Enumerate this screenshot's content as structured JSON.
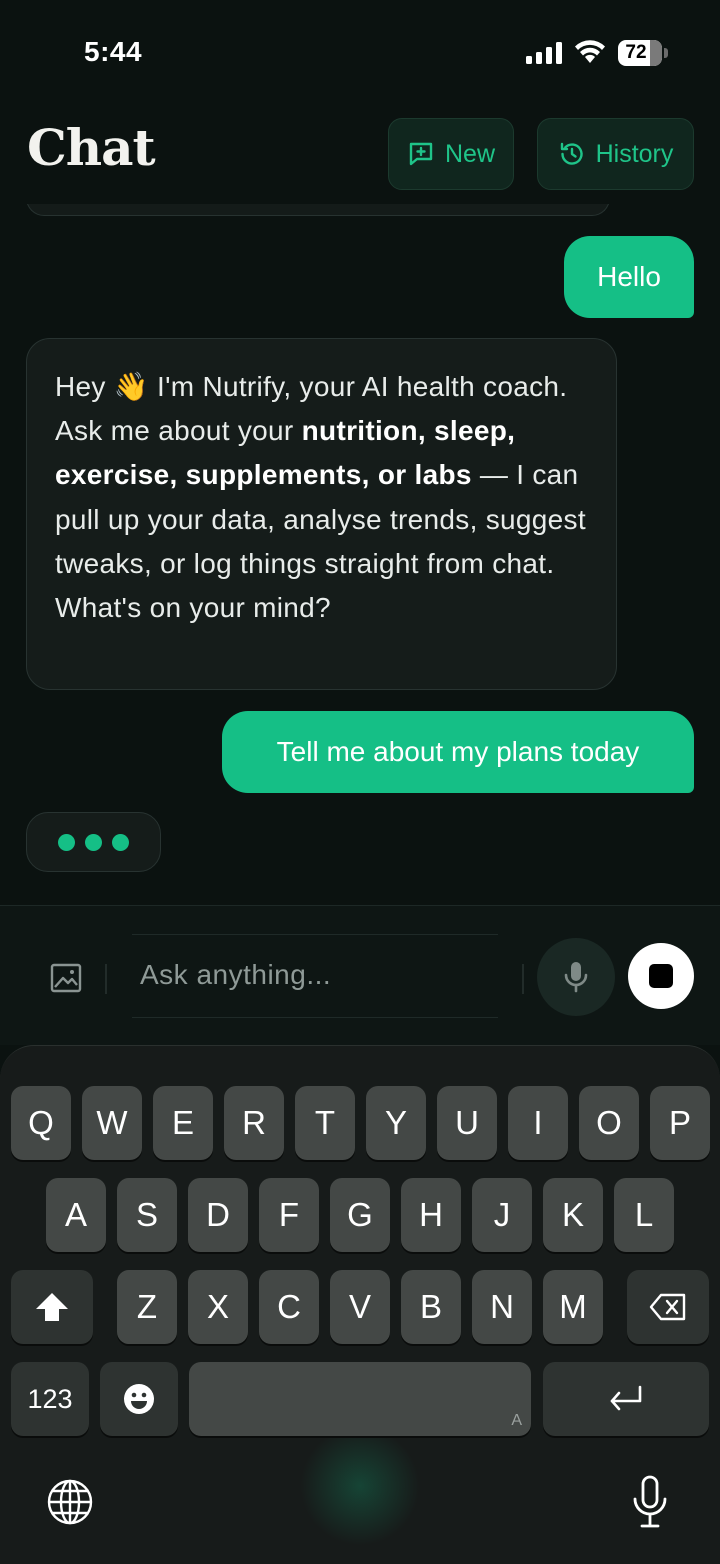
{
  "status": {
    "time": "5:44",
    "battery": "72"
  },
  "header": {
    "title": "Chat",
    "new_label": "New",
    "history_label": "History"
  },
  "messages": {
    "user_1": "Hello",
    "ai_1": {
      "part1": "Hey 👋 I'm Nutrify, your AI health coach. Ask me about your ",
      "bold": "nutrition, sleep, exercise, supplements, or labs",
      "part2": " — I can pull up your data, analyse trends, suggest tweaks, or log things straight from chat. What's on your mind?"
    },
    "user_2": "Tell me about my plans today"
  },
  "composer": {
    "placeholder": "Ask anything..."
  },
  "keyboard": {
    "row1": [
      "Q",
      "W",
      "E",
      "R",
      "T",
      "Y",
      "U",
      "I",
      "O",
      "P"
    ],
    "row2": [
      "A",
      "S",
      "D",
      "F",
      "G",
      "H",
      "J",
      "K",
      "L"
    ],
    "row3": [
      "Z",
      "X",
      "C",
      "V",
      "B",
      "N",
      "M"
    ],
    "numbers_label": "123",
    "space_hint": "A"
  },
  "colors": {
    "accent": "#15bf86",
    "background": "#0b1210",
    "bubble": "#151c1a"
  },
  "icons": [
    "signal-icon",
    "wifi-icon",
    "battery-icon",
    "new-chat-icon",
    "history-icon",
    "image-icon",
    "mic-icon",
    "stop-icon",
    "shift-icon",
    "backspace-icon",
    "emoji-icon",
    "return-icon",
    "globe-icon",
    "dictation-icon"
  ]
}
